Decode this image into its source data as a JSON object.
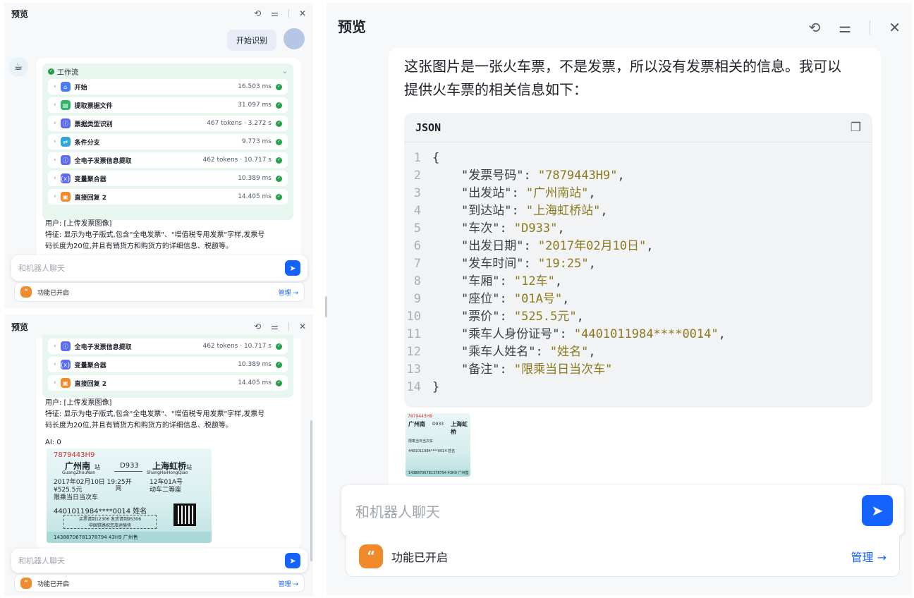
{
  "title": "预览",
  "user_message": "开始识别",
  "workflow": {
    "label": "工作流",
    "steps": [
      {
        "name": "开始",
        "meta": "16.503 ms"
      },
      {
        "name": "提取票据文件",
        "meta": "31.097 ms"
      },
      {
        "name": "票据类型识别",
        "meta": "467 tokens · 3.272 s"
      },
      {
        "name": "条件分支",
        "meta": "9.773 ms"
      },
      {
        "name": "全电子发票信息提取",
        "meta": "462 tokens · 10.717 s"
      },
      {
        "name": "变量聚合器",
        "meta": "10.389 ms"
      },
      {
        "name": "直接回复 2",
        "meta": "14.405 ms"
      }
    ]
  },
  "bot_text": {
    "line1": "用户: [上传发票图像]",
    "line2": "特征: 显示为电子版式,包含\"全电发票\"、\"增值税专用发票\"字样,发票号",
    "line3": "码长度为20位,并且有销货方和购货方的详细信息、税额等。",
    "ai": "AI: 0"
  },
  "ticket": {
    "number": "7879443H9",
    "from": "广州南",
    "from_suffix": "站",
    "from_pinyin": "GuangZhouNan",
    "train": "D933",
    "to": "上海虹桥",
    "to_suffix": "站",
    "to_pinyin": "ShangHaiHongQiao",
    "date": "2017年02月10日 19:25开",
    "car_seat": "12车01A号",
    "price": "¥525.5元",
    "price_suffix": "网",
    "class": "动车二等座",
    "note": "限乘当日当次车",
    "id": "4401011984****0014 姓名",
    "buy_note": "买票请到12306 发货请到95306",
    "slogan": "中国铁路祝您旅途愉快",
    "serial": "14388706781378794 43H9 广州售"
  },
  "chat_placeholder": "和机器人聊天",
  "feature": {
    "label": "功能已开启",
    "manage": "管理 →"
  },
  "right": {
    "intro1": "这张图片是一张火车票，不是发票，所以没有发票相关的信息。我可以",
    "intro2": "提供火车票的相关信息如下：",
    "code_lang": "JSON",
    "code_lines": [
      {
        "n": "1",
        "text": "{"
      },
      {
        "n": "2",
        "k": "\"发票号码\"",
        "v": "\"7879443H9\"",
        "c": ","
      },
      {
        "n": "3",
        "k": "\"出发站\"",
        "v": "\"广州南站\"",
        "c": ","
      },
      {
        "n": "4",
        "k": "\"到达站\"",
        "v": "\"上海虹桥站\"",
        "c": ","
      },
      {
        "n": "5",
        "k": "\"车次\"",
        "v": "\"D933\"",
        "c": ","
      },
      {
        "n": "6",
        "k": "\"出发日期\"",
        "v": "\"2017年02月10日\"",
        "c": ","
      },
      {
        "n": "7",
        "k": "\"发车时间\"",
        "v": "\"19:25\"",
        "c": ","
      },
      {
        "n": "8",
        "k": "\"车厢\"",
        "v": "\"12车\"",
        "c": ","
      },
      {
        "n": "9",
        "k": "\"座位\"",
        "v": "\"01A号\"",
        "c": ","
      },
      {
        "n": "10",
        "k": "\"票价\"",
        "v": "\"525.5元\"",
        "c": ","
      },
      {
        "n": "11",
        "k": "\"乘车人身份证号\"",
        "v": "\"4401011984****0014\"",
        "c": ","
      },
      {
        "n": "12",
        "k": "\"乘车人姓名\"",
        "v": "\"姓名\"",
        "c": ","
      },
      {
        "n": "13",
        "k": "\"备注\"",
        "v": "\"限乘当日当次车\"",
        "c": ""
      },
      {
        "n": "14",
        "text": "}"
      }
    ]
  }
}
